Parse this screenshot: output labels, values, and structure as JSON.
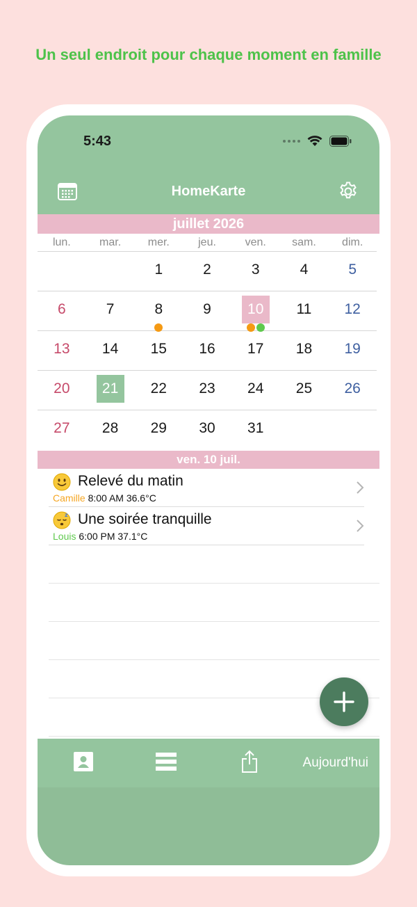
{
  "tagline": "Un seul endroit pour chaque moment en famille",
  "status": {
    "time": "5:43"
  },
  "nav": {
    "title": "HomeKarte",
    "left_icon": "calendar-icon",
    "right_icon": "gear-icon"
  },
  "calendar": {
    "month_label": "juillet 2026",
    "weekdays": [
      "lun.",
      "mar.",
      "mer.",
      "jeu.",
      "ven.",
      "sam.",
      "dim."
    ],
    "weeks": [
      [
        "",
        "",
        "1",
        "2",
        "3",
        "4",
        "5"
      ],
      [
        "6",
        "7",
        "8",
        "9",
        "10",
        "11",
        "12"
      ],
      [
        "13",
        "14",
        "15",
        "16",
        "17",
        "18",
        "19"
      ],
      [
        "20",
        "21",
        "22",
        "23",
        "24",
        "25",
        "26"
      ],
      [
        "27",
        "28",
        "29",
        "30",
        "31",
        "",
        ""
      ]
    ],
    "today": "21",
    "selected": "10",
    "event_dots": {
      "8": [
        "#f59a14"
      ],
      "10": [
        "#f59a14",
        "#5fc94d"
      ]
    }
  },
  "day_header": "ven. 10 juil.",
  "entries": [
    {
      "emoji": "smile-emoji-icon",
      "title": "Relevé du matin",
      "person": "Camille",
      "person_color": "#f5a623",
      "time": "8:00 AM",
      "temp": "36.6°C"
    },
    {
      "emoji": "sleep-emoji-icon",
      "title": "Une soirée tranquille",
      "person": "Louis",
      "person_color": "#5fc94d",
      "time": "6:00 PM",
      "temp": "37.1°C"
    }
  ],
  "tabbar": {
    "today_label": "Aujourd'hui"
  },
  "colors": {
    "header": "#94c59e",
    "pink": "#eab9c9",
    "fab": "#4c7c5e",
    "tagline": "#4dc24a"
  }
}
